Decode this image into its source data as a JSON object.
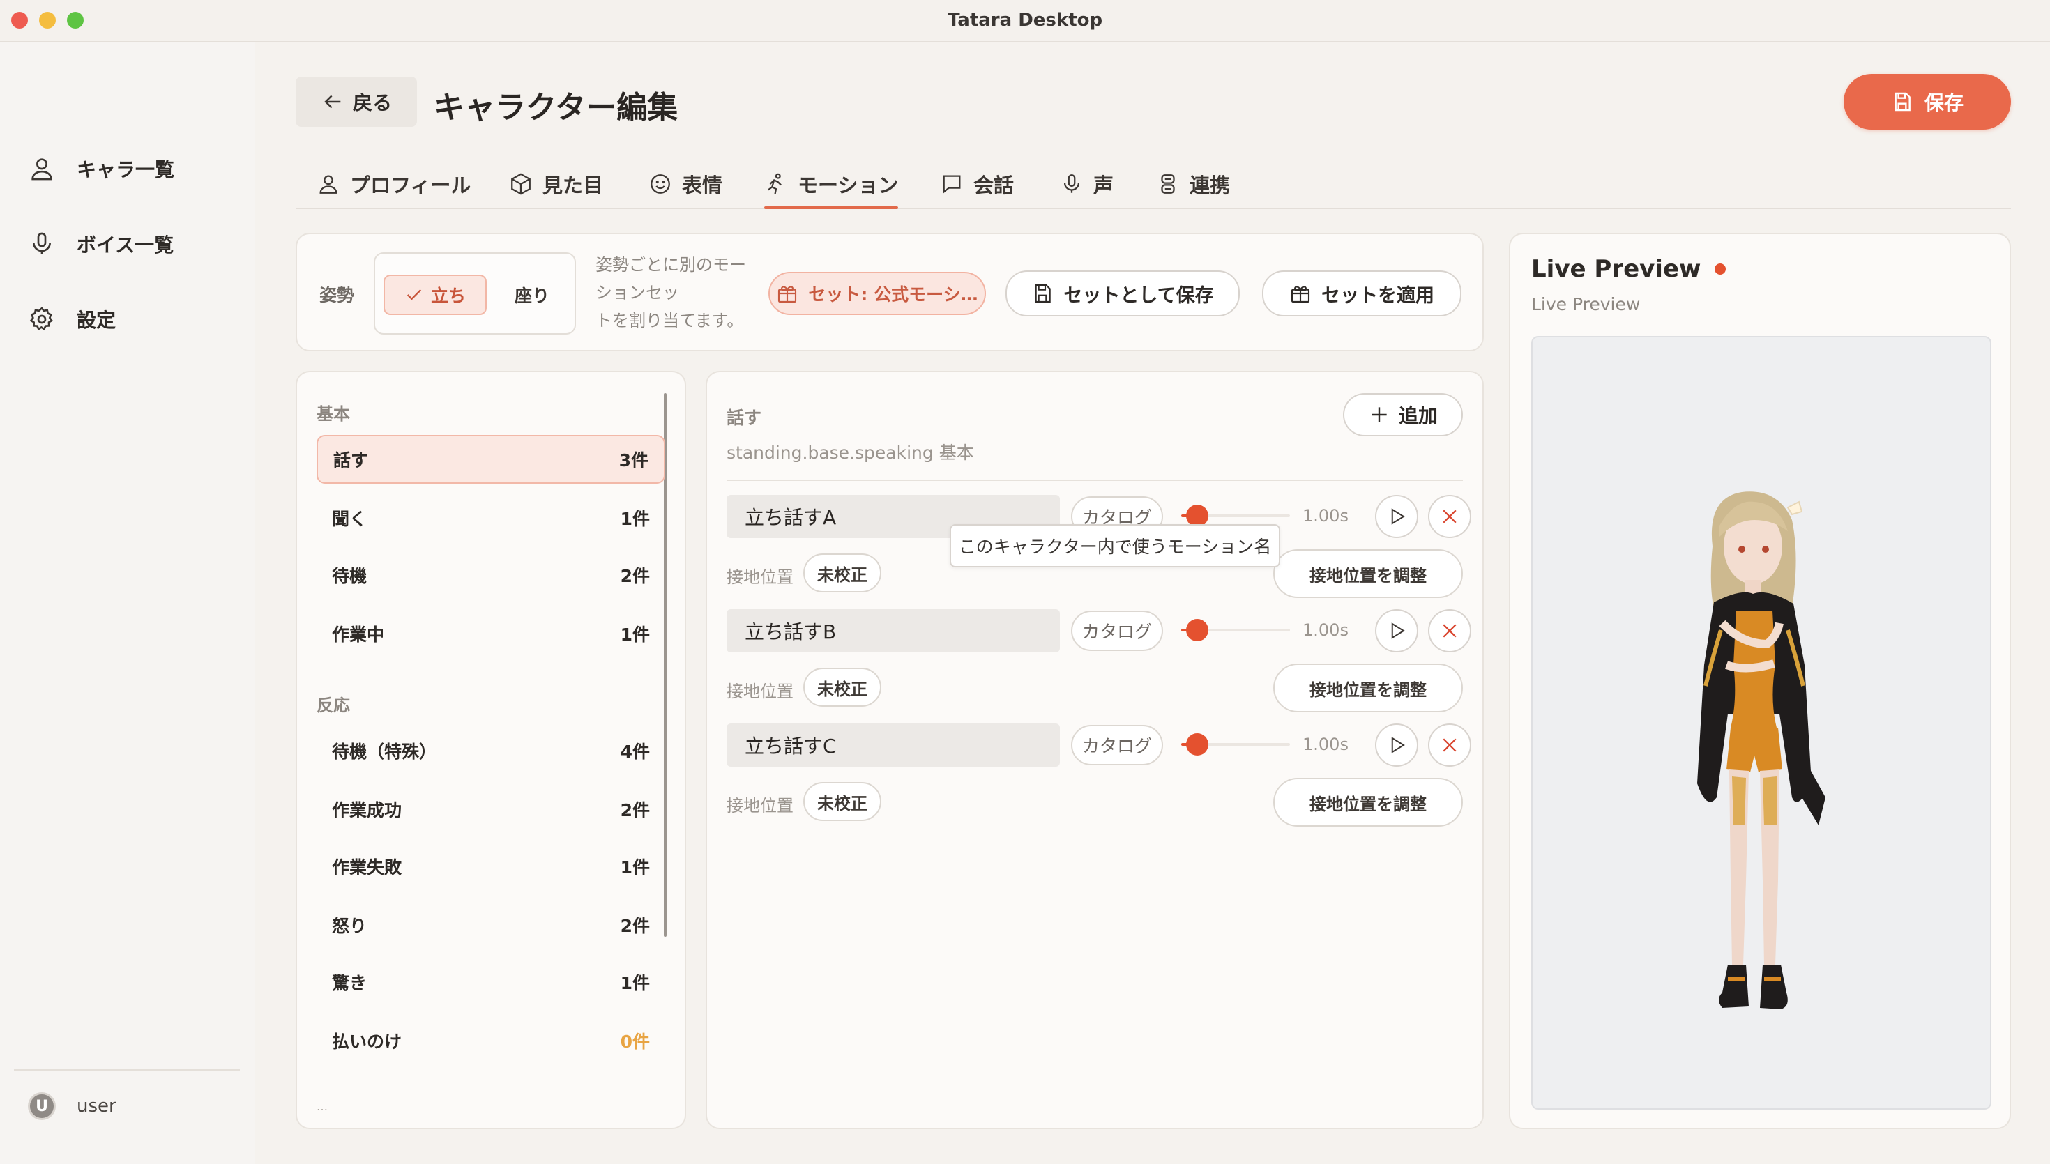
{
  "window": {
    "title": "Tatara Desktop"
  },
  "sidebar": {
    "items": [
      {
        "label": "キャラ一覧",
        "icon": "user-icon"
      },
      {
        "label": "ボイス一覧",
        "icon": "mic-icon"
      },
      {
        "label": "設定",
        "icon": "gear-icon"
      }
    ],
    "user": {
      "avatar_letter": "U",
      "name": "user"
    }
  },
  "header": {
    "back_label": "戻る",
    "title": "キャラクター編集",
    "save_label": "保存"
  },
  "tabs": [
    {
      "label": "プロフィール",
      "icon": "user-icon"
    },
    {
      "label": "見た目",
      "icon": "cube-icon"
    },
    {
      "label": "表情",
      "icon": "smile-icon"
    },
    {
      "label": "モーション",
      "icon": "run-icon",
      "active": true
    },
    {
      "label": "会話",
      "icon": "chat-icon"
    },
    {
      "label": "声",
      "icon": "mic-icon"
    },
    {
      "label": "連携",
      "icon": "link-icon"
    }
  ],
  "posture": {
    "label": "姿勢",
    "options": [
      {
        "label": "立ち",
        "selected": true
      },
      {
        "label": "座り",
        "selected": false
      }
    ],
    "hint_lines": [
      "姿勢ごとに別のモー",
      "ションセッ",
      "トを割り当てます。"
    ],
    "set_chip": "セット: 公式モーシ…",
    "save_as_set": "セットとして保存",
    "apply_set": "セットを適用"
  },
  "motion_list": {
    "groups": [
      {
        "label": "基本",
        "items": [
          {
            "name": "話す",
            "count": "3件",
            "selected": true
          },
          {
            "name": "聞く",
            "count": "1件"
          },
          {
            "name": "待機",
            "count": "2件"
          },
          {
            "name": "作業中",
            "count": "1件"
          }
        ]
      },
      {
        "label": "反応",
        "items": [
          {
            "name": "待機（特殊）",
            "count": "4件"
          },
          {
            "name": "作業成功",
            "count": "2件"
          },
          {
            "name": "作業失敗",
            "count": "1件"
          },
          {
            "name": "怒り",
            "count": "2件"
          },
          {
            "name": "驚き",
            "count": "1件"
          },
          {
            "name": "払いのけ",
            "count": "0件",
            "zero": true
          }
        ]
      }
    ],
    "cutoff_text": "…"
  },
  "detail": {
    "title": "話す",
    "path": "standing.base.speaking  基本",
    "add_label": "追加",
    "catalog_label": "カタログ",
    "contact_label": "接地位置",
    "uncalibrated_label": "未校正",
    "adjust_label": "接地位置を調整",
    "tooltip": "このキャラクター内で使うモーション名",
    "motions": [
      {
        "name": "立ち話すA",
        "duration": "1.00s",
        "slider_value": 0.15
      },
      {
        "name": "立ち話すB",
        "duration": "1.00s",
        "slider_value": 0.15
      },
      {
        "name": "立ち話すC",
        "duration": "1.00s",
        "slider_value": 0.15
      }
    ]
  },
  "preview": {
    "title": "Live Preview",
    "subtitle": "Live Preview"
  },
  "colors": {
    "accent": "#e9694b",
    "live_dot": "#e4512f",
    "zero_count": "#e8a443"
  }
}
